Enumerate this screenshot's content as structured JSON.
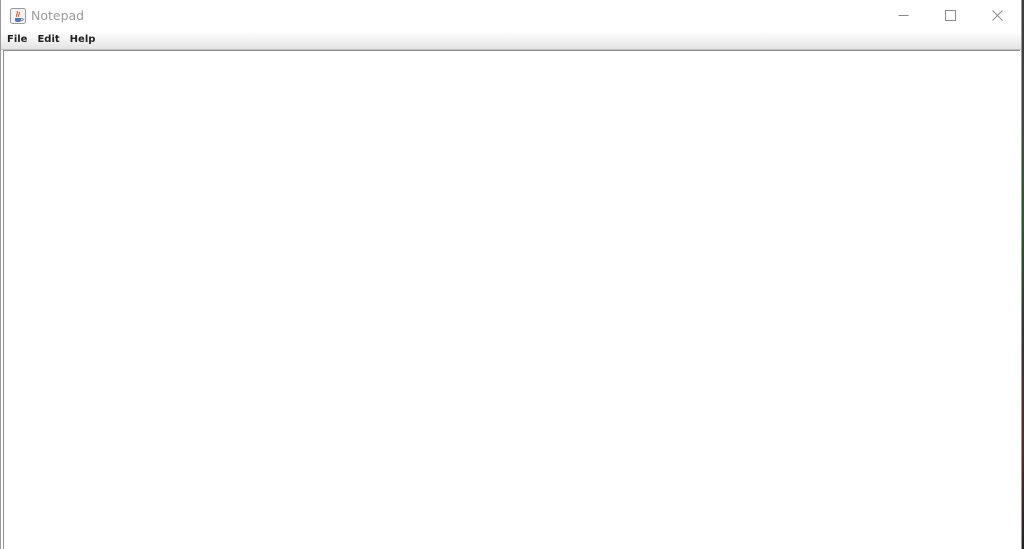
{
  "window": {
    "title": "Notepad",
    "icon": "java-cup-icon",
    "controls": {
      "minimize_icon": "minimize-icon",
      "maximize_icon": "maximize-icon",
      "close_icon": "close-icon"
    }
  },
  "menubar": {
    "items": [
      {
        "label": "File"
      },
      {
        "label": "Edit"
      },
      {
        "label": "Help"
      }
    ]
  },
  "editor": {
    "content": ""
  },
  "colors": {
    "title_text": "#9b9b9b",
    "menu_text": "#222222",
    "caption_glyph": "#8a8a8a"
  }
}
